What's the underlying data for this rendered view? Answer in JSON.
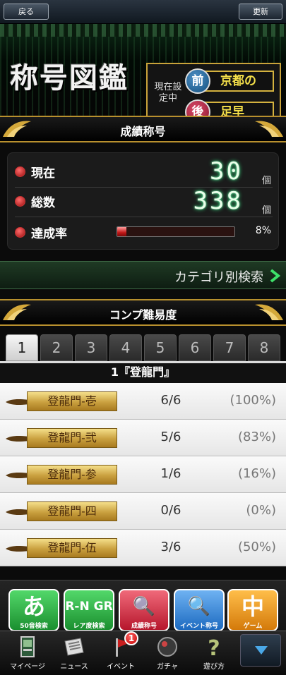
{
  "topbar": {
    "back_label": "戻る",
    "update_label": "更新"
  },
  "header": {
    "title": "称号図鑑",
    "current_label": "現在設定中",
    "prefix": {
      "badge": "前",
      "word": "京都の"
    },
    "suffix": {
      "badge": "後",
      "word": "足早"
    }
  },
  "achievements": {
    "banner": "成績称号",
    "current": {
      "label": "現在",
      "value": "30",
      "unit": "個"
    },
    "total": {
      "label": "総数",
      "value": "338",
      "unit": "個"
    },
    "rate": {
      "label": "達成率",
      "percent_text": "8%",
      "progress": 0.08
    }
  },
  "category_search": {
    "label": "カテゴリ別検索"
  },
  "difficulty": {
    "banner": "コンプ難易度",
    "tabs": [
      "1",
      "2",
      "3",
      "4",
      "5",
      "6",
      "7",
      "8"
    ],
    "active_tab": 0,
    "category_title": "1『登龍門』",
    "rows": [
      {
        "name": "登龍門-壱",
        "count": "6/6",
        "percent": "(100%)"
      },
      {
        "name": "登龍門-弐",
        "count": "5/6",
        "percent": "(83%)"
      },
      {
        "name": "登龍門-参",
        "count": "1/6",
        "percent": "(16%)"
      },
      {
        "name": "登龍門-四",
        "count": "0/6",
        "percent": "(0%)"
      },
      {
        "name": "登龍門-伍",
        "count": "3/6",
        "percent": "(50%)"
      }
    ]
  },
  "dock": {
    "shortcuts": [
      {
        "glyph": "あ",
        "caption": "50音検索",
        "color": "green",
        "icon": "hiragana-a-icon"
      },
      {
        "glyph": "R-N GR",
        "caption": "レア度検索",
        "color": "green",
        "icon": "rarity-icon"
      },
      {
        "glyph": "🔍",
        "caption": "成績称号",
        "color": "red",
        "icon": "search-icon"
      },
      {
        "glyph": "🔍",
        "caption": "イベント称号",
        "color": "blue",
        "icon": "search-icon"
      },
      {
        "glyph": "中",
        "caption": "ゲーム",
        "color": "orange",
        "icon": "mahjong-tile-icon"
      }
    ],
    "nav": [
      {
        "label": "マイページ",
        "icon": "mypage-card-icon"
      },
      {
        "label": "ニュース",
        "icon": "newspaper-icon"
      },
      {
        "label": "イベント",
        "icon": "event-flag-icon",
        "badge": "1"
      },
      {
        "label": "ガチャ",
        "icon": "gacha-ball-icon"
      },
      {
        "label": "遊び方",
        "icon": "question-mark-icon"
      }
    ],
    "more_icon": "triangle-down-icon"
  },
  "colors": {
    "gold": "#c9a33a",
    "digital_green": "#35f08a",
    "progress_red": "#c21818"
  }
}
